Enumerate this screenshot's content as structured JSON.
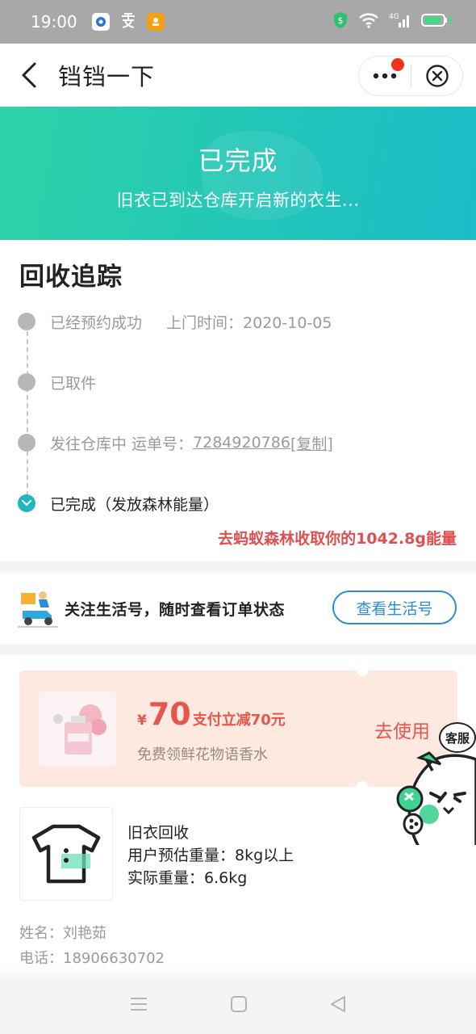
{
  "status_bar": {
    "time": "19:00",
    "network": "4G"
  },
  "nav": {
    "title": "铛铛一下"
  },
  "banner": {
    "title": "已完成",
    "subtitle": "旧衣已到达仓库开启新的衣生..."
  },
  "tracking": {
    "heading": "回收追踪",
    "steps": [
      {
        "label": "已经预约成功",
        "time": "上门时间：2020-10-05"
      },
      {
        "label": "已取件"
      },
      {
        "label": "发往仓库中 运单号：",
        "waybill": "7284920786",
        "copy": "[复制]"
      },
      {
        "label": "已完成（发放森林能量）"
      }
    ],
    "energy_link": "去蚂蚁森林收取你的1042.8g能量"
  },
  "follow": {
    "text": "关注生活号，随时查看订单状态",
    "button": "查看生活号"
  },
  "coupon": {
    "currency": "¥",
    "amount": "70",
    "desc": "支付立减70元",
    "subtitle": "免费领鲜花物语香水",
    "action": "去使用"
  },
  "product": {
    "name": "旧衣回收",
    "estimated_weight": "用户预估重量：8kg以上",
    "actual_weight": "实际重量：6.6kg"
  },
  "customer": {
    "name": "姓名：刘艳茹",
    "phone": "电话：18906630702"
  },
  "customer_service": {
    "label": "客服"
  },
  "colors": {
    "teal": "#22c7b7",
    "red": "#e04f4f",
    "blue": "#2d8cd6"
  }
}
